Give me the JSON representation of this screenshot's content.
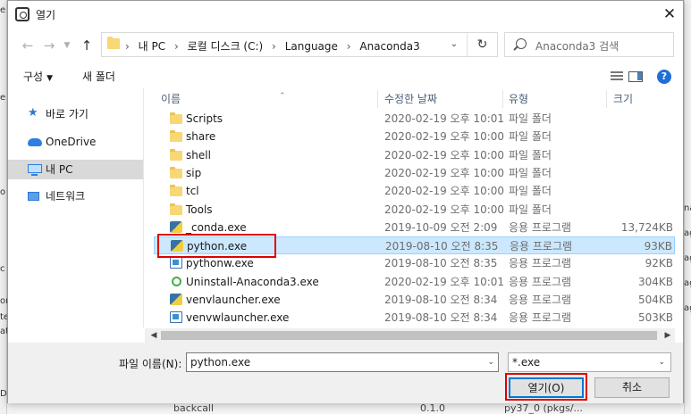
{
  "background": {
    "left_fragments": [
      "e",
      "e",
      "o",
      "c",
      "on",
      "te",
      "at",
      "D"
    ],
    "right_fragments": [
      "na",
      "ag",
      "ag",
      "ag",
      "ag"
    ],
    "bottom_texts": [
      "backcall",
      "0.1.0",
      "py37_0 (pkgs/..."
    ]
  },
  "title": "열기",
  "close": "✕",
  "breadcrumb": [
    "내 PC",
    "로컬 디스크 (C:)",
    "Language",
    "Anaconda3"
  ],
  "search_placeholder": "Anaconda3 검색",
  "toolbar": {
    "organize": "구성",
    "new_folder": "새 폴더",
    "help": "?"
  },
  "nav": [
    "바로 가기",
    "OneDrive",
    "내 PC",
    "네트워크"
  ],
  "nav_selected": "내 PC",
  "columns": {
    "name": "이름",
    "date": "수정한 날짜",
    "type": "유형",
    "size": "크기"
  },
  "files": [
    {
      "name": "Scripts",
      "date": "2020-02-19 오후 10:01",
      "type": "파일 폴더",
      "size": "",
      "icon": "folder-icon"
    },
    {
      "name": "share",
      "date": "2020-02-19 오후 10:00",
      "type": "파일 폴더",
      "size": "",
      "icon": "folder-icon"
    },
    {
      "name": "shell",
      "date": "2020-02-19 오후 10:00",
      "type": "파일 폴더",
      "size": "",
      "icon": "folder-icon"
    },
    {
      "name": "sip",
      "date": "2020-02-19 오후 10:00",
      "type": "파일 폴더",
      "size": "",
      "icon": "folder-icon"
    },
    {
      "name": "tcl",
      "date": "2020-02-19 오후 10:00",
      "type": "파일 폴더",
      "size": "",
      "icon": "folder-icon"
    },
    {
      "name": "Tools",
      "date": "2020-02-19 오후 10:00",
      "type": "파일 폴더",
      "size": "",
      "icon": "folder-icon"
    },
    {
      "name": "_conda.exe",
      "date": "2019-10-09 오전 2:09",
      "type": "응용 프로그램",
      "size": "13,724KB",
      "icon": "python-exe-icon"
    },
    {
      "name": "python.exe",
      "date": "2019-08-10 오전 8:35",
      "type": "응용 프로그램",
      "size": "93KB",
      "icon": "python-exe-icon"
    },
    {
      "name": "pythonw.exe",
      "date": "2019-08-10 오전 8:35",
      "type": "응용 프로그램",
      "size": "92KB",
      "icon": "app-exe-icon"
    },
    {
      "name": "Uninstall-Anaconda3.exe",
      "date": "2020-02-19 오후 10:01",
      "type": "응용 프로그램",
      "size": "304KB",
      "icon": "conda-uninstall-icon"
    },
    {
      "name": "venvlauncher.exe",
      "date": "2019-08-10 오전 8:34",
      "type": "응용 프로그램",
      "size": "504KB",
      "icon": "python-exe-icon"
    },
    {
      "name": "venvwlauncher.exe",
      "date": "2019-08-10 오전 8:34",
      "type": "응용 프로그램",
      "size": "503KB",
      "icon": "app-exe-icon"
    }
  ],
  "selected_file": "python.exe",
  "filename_label": "파일 이름(N):",
  "filename_value": "python.exe",
  "file_type": "*.exe",
  "open_button": "열기(O)",
  "cancel_button": "취소",
  "colors": {
    "selection": "#cce8ff",
    "highlight": "#e00000",
    "accent": "#0078d7"
  }
}
